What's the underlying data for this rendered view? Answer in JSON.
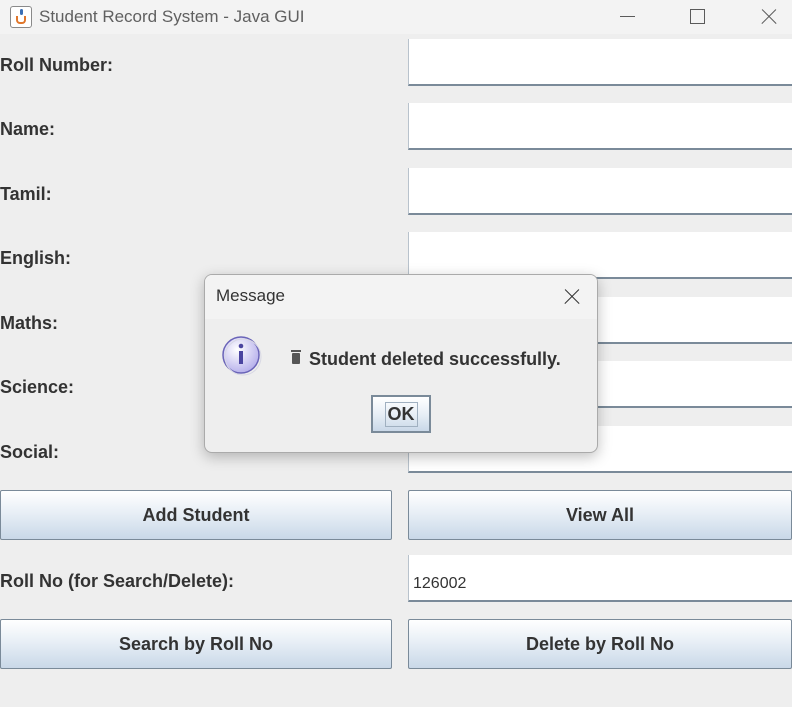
{
  "window": {
    "title": "Student Record System - Java GUI",
    "app_icon": "java-cup-icon",
    "controls": [
      "minimize-icon",
      "maximize-icon",
      "close-icon"
    ]
  },
  "form": {
    "fields": [
      {
        "label": "Roll Number:",
        "value": ""
      },
      {
        "label": "Name:",
        "value": ""
      },
      {
        "label": "Tamil:",
        "value": ""
      },
      {
        "label": "English:",
        "value": ""
      },
      {
        "label": "Maths:",
        "value": ""
      },
      {
        "label": "Science:",
        "value": ""
      },
      {
        "label": "Social:",
        "value": ""
      }
    ],
    "add_button": "Add Student",
    "view_all_button": "View All",
    "search_label": "Roll No (for Search/Delete):",
    "search_value": "126002",
    "search_button": "Search by Roll No",
    "delete_button": "Delete by Roll No"
  },
  "dialog": {
    "title": "Message",
    "icon": "info-icon",
    "message_glyph": "trash-icon",
    "message": "Student deleted successfully.",
    "ok_label": "OK"
  },
  "colors": {
    "background": "#eeeeee",
    "button_border": "#7a8a99",
    "button_gradient_bottom": "#c9d8e8",
    "info_icon_fill": "#c8c4f0",
    "info_icon_stroke": "#6a64b8"
  }
}
